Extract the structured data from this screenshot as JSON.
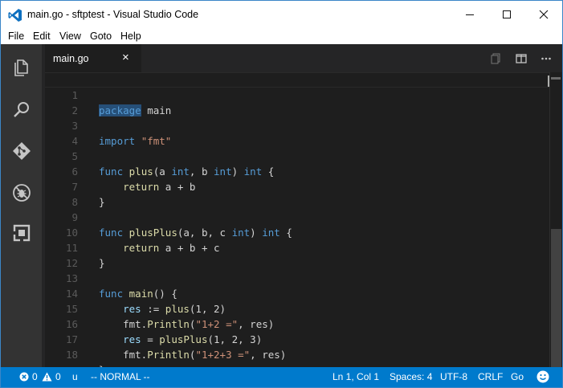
{
  "window": {
    "title": "main.go - sftptest - Visual Studio Code",
    "controls": [
      "minimize",
      "maximize",
      "close"
    ]
  },
  "menu": [
    "File",
    "Edit",
    "View",
    "Goto",
    "Help"
  ],
  "activity_bar": [
    "explorer-icon",
    "search-icon",
    "git-icon",
    "debug-icon",
    "extensions-icon"
  ],
  "tab": {
    "filename": "main.go",
    "close_glyph": "×"
  },
  "editor": {
    "lines": [
      {
        "n": "1",
        "text": "package main"
      },
      {
        "n": "2",
        "text": ""
      },
      {
        "n": "3",
        "text": "import \"fmt\""
      },
      {
        "n": "4",
        "text": ""
      },
      {
        "n": "5",
        "text": "func plus(a int, b int) int {"
      },
      {
        "n": "6",
        "text": "    return a + b"
      },
      {
        "n": "7",
        "text": "}"
      },
      {
        "n": "8",
        "text": ""
      },
      {
        "n": "9",
        "text": "func plusPlus(a, b, c int) int {"
      },
      {
        "n": "10",
        "text": "    return a + b + c"
      },
      {
        "n": "11",
        "text": "}"
      },
      {
        "n": "12",
        "text": ""
      },
      {
        "n": "13",
        "text": "func main() {"
      },
      {
        "n": "14",
        "text": "    res := plus(1, 2)"
      },
      {
        "n": "15",
        "text": "    fmt.Println(\"1+2 =\", res)"
      },
      {
        "n": "16",
        "text": "    res = plusPlus(1, 2, 3)"
      },
      {
        "n": "17",
        "text": "    fmt.Println(\"1+2+3 =\", res)"
      },
      {
        "n": "18",
        "text": "}"
      }
    ]
  },
  "status": {
    "errors": "0",
    "warnings": "0",
    "u": "u",
    "mode": "-- NORMAL --",
    "position": "Ln 1, Col 1",
    "spaces": "Spaces: 4",
    "encoding": "UTF-8",
    "eol": "CRLF",
    "language": "Go"
  },
  "colors": {
    "accent": "#007acc",
    "keyword": "#569cd6",
    "string": "#ce9178",
    "function": "#dcdcaa",
    "variable": "#9cdcfe"
  }
}
